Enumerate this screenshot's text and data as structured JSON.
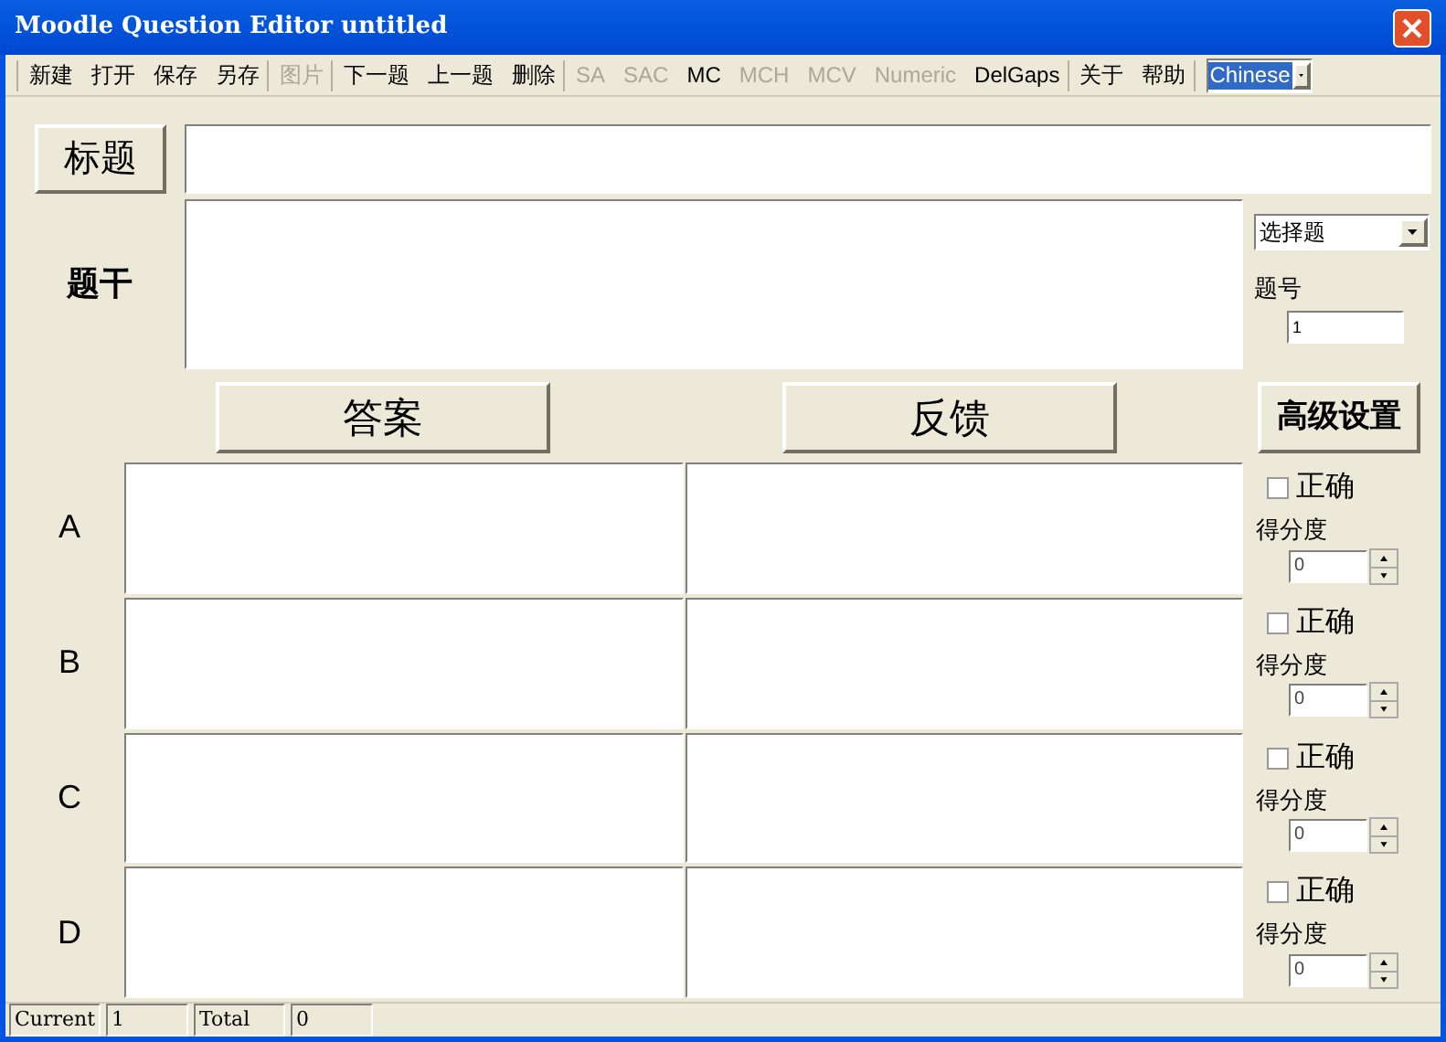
{
  "window": {
    "title": "Moodle Question Editor untitled"
  },
  "toolbar": [
    [
      {
        "label": "新建",
        "disabled": false
      },
      {
        "label": "打开",
        "disabled": false
      },
      {
        "label": "保存",
        "disabled": false
      },
      {
        "label": "另存",
        "disabled": false
      }
    ],
    [
      {
        "label": "图片",
        "disabled": true
      }
    ],
    [
      {
        "label": "下一题",
        "disabled": false
      },
      {
        "label": "上一题",
        "disabled": false
      },
      {
        "label": "删除",
        "disabled": false
      }
    ],
    [
      {
        "label": "SA",
        "disabled": true
      },
      {
        "label": "SAC",
        "disabled": true
      },
      {
        "label": "MC",
        "disabled": false
      },
      {
        "label": "MCH",
        "disabled": true
      },
      {
        "label": "MCV",
        "disabled": true
      },
      {
        "label": "Numeric",
        "disabled": true
      },
      {
        "label": "DelGaps",
        "disabled": false
      }
    ],
    [
      {
        "label": "关于",
        "disabled": false
      },
      {
        "label": "帮助",
        "disabled": false
      }
    ]
  ],
  "language": {
    "value": "Chinese"
  },
  "title_button": "标题",
  "stem_label": "题干",
  "question_type": {
    "value": "选择题"
  },
  "number_label": "题号",
  "number_value": "1",
  "answer_button": "答案",
  "feedback_button": "反馈",
  "advanced_button": "高级设置",
  "options": [
    {
      "letter": "A",
      "correct_label": "正确",
      "checked": false,
      "score_label": "得分度",
      "score": "0"
    },
    {
      "letter": "B",
      "correct_label": "正确",
      "checked": false,
      "score_label": "得分度",
      "score": "0"
    },
    {
      "letter": "C",
      "correct_label": "正确",
      "checked": false,
      "score_label": "得分度",
      "score": "0"
    },
    {
      "letter": "D",
      "correct_label": "正确",
      "checked": false,
      "score_label": "得分度",
      "score": "0"
    }
  ],
  "status_bar": [
    {
      "label": "Current",
      "value": "1"
    },
    {
      "label": "Total",
      "value": "0"
    }
  ]
}
